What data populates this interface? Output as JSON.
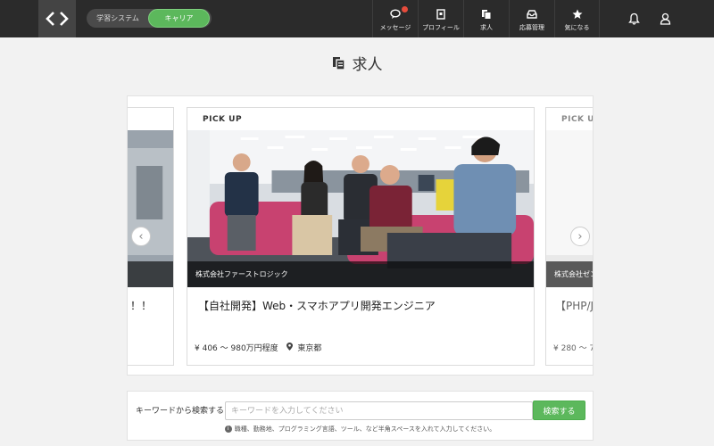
{
  "header": {
    "toggle": {
      "left": "学習システム",
      "right": "キャリア"
    },
    "nav": [
      {
        "label": "メッセージ",
        "icon": "chat-icon",
        "badge": true
      },
      {
        "label": "プロフィール",
        "icon": "profile-icon",
        "badge": false
      },
      {
        "label": "求人",
        "icon": "jobs-icon",
        "badge": false
      },
      {
        "label": "応募管理",
        "icon": "inbox-icon",
        "badge": false
      },
      {
        "label": "気になる",
        "icon": "star-icon",
        "badge": false
      }
    ]
  },
  "page": {
    "title": "求人"
  },
  "carousel": {
    "prev": {
      "title": "！！"
    },
    "main": {
      "pickup": "PICK UP",
      "company": "株式会社ファーストロジック",
      "title": "【自社開発】Web・スマホアプリ開発エンジニア",
      "salary": "¥ 406 〜 980万円程度",
      "location": "東京都"
    },
    "next": {
      "pickup": "PICK UP",
      "company": "株式会社ゼン",
      "title": "【PHP/Ja ョンの開",
      "salary": "¥ 280 〜 7"
    }
  },
  "search": {
    "label": "キーワードから検索する",
    "placeholder": "キーワードを入力してください",
    "button": "検索する",
    "hint": "職種、勤務地、プログラミング言語、ツール、など半角スペースを入れて入力してください。"
  },
  "colors": {
    "accent": "#5cb85c",
    "header": "#2b2b2b",
    "badge": "#e74c3c"
  }
}
